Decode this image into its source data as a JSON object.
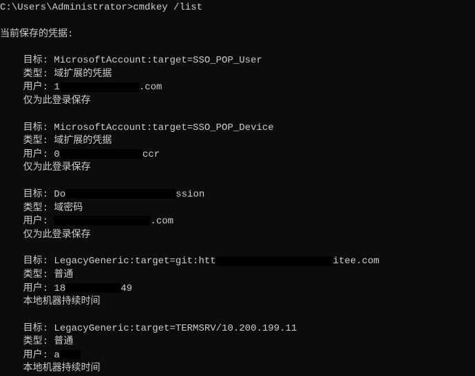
{
  "prompt": "C:\\Users\\Administrator>",
  "command": "cmdkey /list",
  "header": "当前保存的凭据:",
  "labels": {
    "target": "目标:",
    "type": "类型:",
    "user": "用户:"
  },
  "entries": [
    {
      "target": "MicrosoftAccount:target=SSO_POP_User",
      "type": "域扩展的凭据",
      "user_prefix": "1",
      "user_suffix": ".com",
      "persist": "仅为此登录保存",
      "redact_width": 115
    },
    {
      "target": "MicrosoftAccount:target=SSO_POP_Device",
      "type": "域扩展的凭据",
      "user_prefix": "0",
      "user_suffix": "ccr",
      "persist": "仅为此登录保存",
      "redact_width": 120
    },
    {
      "target_prefix": "Do",
      "target_suffix": "ssion",
      "type": "域密码",
      "user_prefix": "",
      "user_suffix": ".com",
      "persist": "仅为此登录保存",
      "redact_width_target": 160,
      "redact_width": 140
    },
    {
      "target_prefix": "LegacyGeneric:target=git:htt",
      "target_suffix": "itee.com",
      "type": "普通",
      "user_prefix": "18",
      "user_suffix": "49",
      "persist": "本地机器持续时间",
      "redact_width_target": 170,
      "redact_width": 80
    },
    {
      "target": "LegacyGeneric:target=TERMSRV/10.200.199.11",
      "type": "普通",
      "user_prefix": "a",
      "user_suffix": "",
      "persist": "本地机器持续时间",
      "redact_width": 30
    }
  ]
}
